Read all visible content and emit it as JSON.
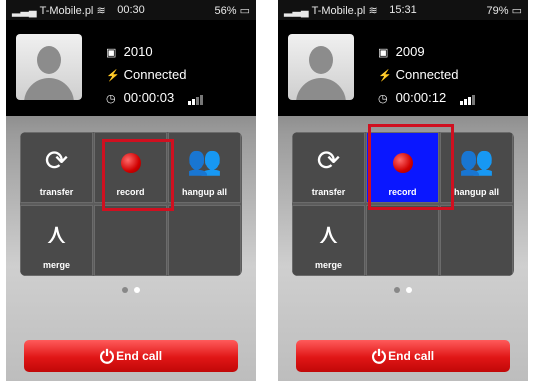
{
  "left": {
    "status": {
      "carrier": "T-Mobile.pl",
      "time": "00:30",
      "battery": "56%"
    },
    "contact": {
      "number": "2010",
      "state": "Connected",
      "duration": "00:00:03"
    },
    "buttons": {
      "transfer": "transfer",
      "record": "record",
      "hangup_all": "hangup all",
      "merge": "merge"
    },
    "record_selected": false,
    "end_call": "End call"
  },
  "right": {
    "status": {
      "carrier": "T-Mobile.pl",
      "time": "15:31",
      "battery": "79%"
    },
    "contact": {
      "number": "2009",
      "state": "Connected",
      "duration": "00:00:12"
    },
    "buttons": {
      "transfer": "transfer",
      "record": "record",
      "hangup_all": "hangup all",
      "merge": "merge"
    },
    "record_selected": true,
    "end_call": "End call"
  },
  "colors": {
    "highlight_border": "#d01020",
    "record_active_bg": "#0a17ff",
    "end_call": "#e01616"
  }
}
